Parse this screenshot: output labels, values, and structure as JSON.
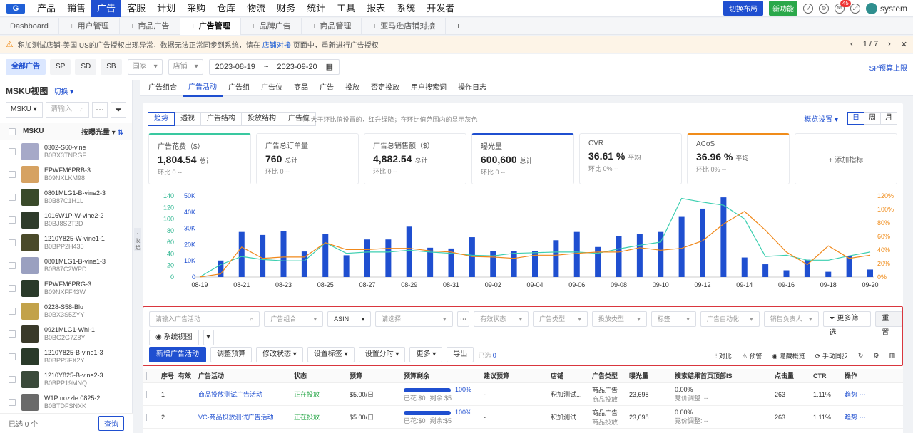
{
  "topnav": {
    "logo": "G",
    "menu": [
      "产品",
      "销售",
      "广告",
      "客服",
      "计划",
      "采购",
      "仓库",
      "物流",
      "财务",
      "统计",
      "工具",
      "报表",
      "系统",
      "开发者"
    ],
    "active_index": 2,
    "switch_layout": "切换布局",
    "new_feature": "新功能",
    "badge_count": "45",
    "user": "system"
  },
  "tabs": [
    {
      "label": "Dashboard",
      "pinned": false
    },
    {
      "label": "用户管理",
      "pinned": true
    },
    {
      "label": "商品广告",
      "pinned": true
    },
    {
      "label": "广告管理",
      "pinned": true,
      "active": true
    },
    {
      "label": "品牌广告",
      "pinned": true
    },
    {
      "label": "商品管理",
      "pinned": true
    },
    {
      "label": "亚马逊店铺对接",
      "pinned": true
    },
    {
      "label": "+",
      "pinned": false
    }
  ],
  "notice": {
    "text1": "积加测试店铺-美国:US的广告授权出现异常，数据无法正常同步到系统，请在",
    "link": "店铺对接",
    "text2": "页面中，重新进行广告授权",
    "pager": "1 / 7"
  },
  "filterbar": {
    "chips": [
      "全部广告",
      "SP",
      "SD",
      "SB"
    ],
    "country": "国家",
    "store": "店铺",
    "date_from": "2023-08-19",
    "date_sep": "~",
    "date_to": "2023-09-20",
    "right_link": "SP预算上限"
  },
  "sidebar": {
    "title": "MSKU视图",
    "switch": "切换",
    "search_type": "MSKU",
    "search_ph": "请输入",
    "col_msku": "MSKU",
    "col_sort": "按曝光量",
    "items": [
      {
        "name": "0302-S60-vine",
        "asin": "B0BX3TNRGF",
        "color": "#a6a9c8"
      },
      {
        "name": "EPWFM6PRB-3",
        "asin": "B09NXLKM98",
        "color": "#d6a262"
      },
      {
        "name": "0801MLG1-B-vine2-3",
        "asin": "B0B87C1H1L",
        "color": "#3a4a2a"
      },
      {
        "name": "1016W1P-W-vine2-2",
        "asin": "B0BJ8S2T2D",
        "color": "#2e3b2a"
      },
      {
        "name": "1210Y825-W-vine1-1",
        "asin": "B0BPP2H435",
        "color": "#4a4a2a"
      },
      {
        "name": "0801MLG1-B-vine1-3",
        "asin": "B0B87C2WPD",
        "color": "#9aa0c0"
      },
      {
        "name": "EPWFM6PRG-3",
        "asin": "B09NXFF43W",
        "color": "#2a3a2a"
      },
      {
        "name": "0228-S58-Blu",
        "asin": "B0BX3S5ZYY",
        "color": "#c2a24a"
      },
      {
        "name": "0921MLG1-Whi-1",
        "asin": "B0BG2G7Z8Y",
        "color": "#3a3a2a"
      },
      {
        "name": "1210Y825-B-vine1-3",
        "asin": "B0BPP5FX2Y",
        "color": "#2a3a2a"
      },
      {
        "name": "1210Y825-B-vine2-3",
        "asin": "B0BPP19MNQ",
        "color": "#3a4a3a"
      },
      {
        "name": "W1P nozzle 0825-2",
        "asin": "B0BTDFSNXK",
        "color": "#6a6a6a"
      }
    ],
    "footer": "已选 0 个",
    "query": "查询"
  },
  "collapse_label": "收起",
  "subtabs": {
    "items": [
      "广告组合",
      "广告活动",
      "广告组",
      "广告位",
      "商品",
      "广告",
      "投放",
      "否定投放",
      "用户搜索词",
      "操作日志"
    ],
    "active_index": 1
  },
  "card": {
    "seg": [
      "趋势",
      "透视",
      "广告结构",
      "投放结构",
      "广告位"
    ],
    "seg_active": 0,
    "hint": "大于环比值设置的，红升绿降；在环比值范围内的显示灰色",
    "settings": "概览设置",
    "dwm": [
      "日",
      "周",
      "月"
    ],
    "dwm_active": 0
  },
  "metrics": [
    {
      "title": "广告花费（$）",
      "value": "1,804.54",
      "suffix": "总计",
      "cmp": "环比  0  --",
      "accent": "green"
    },
    {
      "title": "广告总订单量",
      "value": "760",
      "suffix": "总计",
      "cmp": "环比  0  --",
      "accent": "none"
    },
    {
      "title": "广告总销售额（$）",
      "value": "4,882.54",
      "suffix": "总计",
      "cmp": "环比  0  --",
      "accent": "none"
    },
    {
      "title": "曝光量",
      "value": "600,600",
      "suffix": "总计",
      "cmp": "环比  0  --",
      "accent": "blue"
    },
    {
      "title": "CVR",
      "value": "36.61 %",
      "suffix": "平均",
      "cmp": "环比  0%  --",
      "accent": "none"
    },
    {
      "title": "ACoS",
      "value": "36.96 %",
      "suffix": "平均",
      "cmp": "环比  0%  --",
      "accent": "orange"
    },
    {
      "title": "+ 添加指标",
      "value": "",
      "suffix": "",
      "cmp": "",
      "accent": "add"
    }
  ],
  "chart_data": {
    "type": "bar+line",
    "x": [
      "08-19",
      "08-20",
      "08-21",
      "08-22",
      "08-23",
      "08-24",
      "08-25",
      "08-26",
      "08-27",
      "08-28",
      "08-29",
      "08-30",
      "08-31",
      "09-01",
      "09-02",
      "09-03",
      "09-04",
      "09-05",
      "09-06",
      "09-07",
      "09-08",
      "09-09",
      "09-10",
      "09-11",
      "09-12",
      "09-13",
      "09-14",
      "09-15",
      "09-16",
      "09-17",
      "09-18",
      "09-19",
      "09-20"
    ],
    "xticks": [
      "08-19",
      "08-21",
      "08-23",
      "08-25",
      "08-27",
      "08-29",
      "08-31",
      "09-02",
      "09-04",
      "09-06",
      "09-08",
      "09-10",
      "09-12",
      "09-14",
      "09-16",
      "09-18",
      "09-20"
    ],
    "left1_ticks": [
      "140",
      "120",
      "100",
      "80",
      "60",
      "40",
      "20",
      "0"
    ],
    "left2_ticks": [
      "50K",
      "40K",
      "30K",
      "20K",
      "10K",
      "0"
    ],
    "right_ticks": [
      "120%",
      "100%",
      "80%",
      "60%",
      "40%",
      "20%",
      "0%"
    ],
    "bars": [
      0,
      11000,
      30000,
      28000,
      30500,
      17000,
      28500,
      14500,
      25000,
      25000,
      33500,
      19500,
      19000,
      26500,
      17500,
      17500,
      17500,
      24500,
      30000,
      20000,
      27000,
      28500,
      30000,
      40000,
      45500,
      53000,
      13000,
      8500,
      4500,
      11500,
      3500,
      14000,
      5000
    ],
    "line_teal": [
      0,
      20,
      33,
      28,
      26,
      26,
      55,
      38,
      40,
      40,
      43,
      40,
      38,
      35,
      34,
      38,
      39,
      40,
      40,
      38,
      45,
      51,
      56,
      126,
      120,
      115,
      93,
      33,
      35,
      27,
      27,
      34,
      40
    ],
    "line_orange": [
      0,
      5,
      48,
      30,
      32,
      32,
      55,
      44,
      44,
      46,
      46,
      42,
      40,
      33,
      32,
      30,
      35,
      35,
      38,
      40,
      40,
      47,
      43,
      46,
      58,
      85,
      105,
      75,
      40,
      20,
      50,
      30,
      35
    ]
  },
  "ops": {
    "search_ph": "请输入广告活动",
    "portfolio": "广告组合",
    "asin": "ASIN",
    "asin_ph": "请选择",
    "status": "有效状态",
    "adtype": "广告类型",
    "target": "投放类型",
    "tag": "标签",
    "auto": "广告自动化",
    "owner": "销售负责人",
    "more_filter": "更多筛选",
    "reset": "重置",
    "view": "系统视图",
    "new_btn": "新增广告活动",
    "adjust_budget": "调整预算",
    "change_status": "修改状态",
    "set_tag": "设置标签",
    "set_time": "设置分时",
    "more": "更多",
    "export": "导出",
    "selected": "已选",
    "selected_count": "0",
    "right": [
      "对比",
      "预警",
      "隐藏概览",
      "手动同步"
    ]
  },
  "table": {
    "headers": [
      "序号",
      "有效",
      "广告活动",
      "状态",
      "预算",
      "预算剩余",
      "建议预算",
      "店铺",
      "广告类型",
      "曝光量",
      "搜索结果首页顶部IS",
      "点击量",
      "CTR",
      "操作"
    ],
    "rows": [
      {
        "idx": "1",
        "name": "商品投放测试广告活动",
        "status": "正在投放",
        "budget": "$5.00/日",
        "remain_pct": "100%",
        "spent": "已花:$0",
        "left": "剩余:$5",
        "suggest": "-",
        "store": "积加测试...",
        "type1": "商品广告",
        "type2": "商品投放",
        "imp": "23,698",
        "is": "0.00%",
        "is2": "竞价调整: --",
        "clicks": "263",
        "ctr": "1.11%",
        "op": "趋势"
      },
      {
        "idx": "2",
        "name": "VC-商品投放测试广告活动",
        "status": "正在投放",
        "budget": "$5.00/日",
        "remain_pct": "100%",
        "spent": "已花:$0",
        "left": "剩余:$5",
        "suggest": "-",
        "store": "积加测试...",
        "type1": "商品广告",
        "type2": "商品投放",
        "imp": "23,698",
        "is": "0.00%",
        "is2": "竞价调整: --",
        "clicks": "263",
        "ctr": "1.11%",
        "op": "趋势"
      }
    ]
  }
}
